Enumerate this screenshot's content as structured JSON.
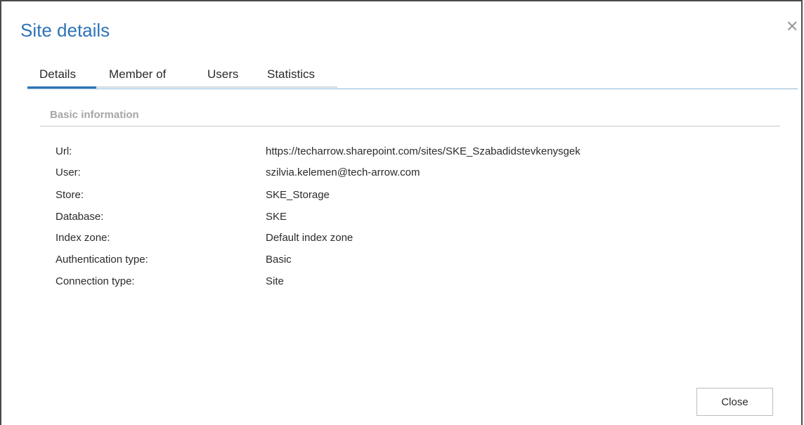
{
  "dialog": {
    "title": "Site details",
    "close_icon": "close-icon"
  },
  "tabs": [
    {
      "label": "Details",
      "active": true
    },
    {
      "label": "Member of",
      "active": false
    },
    {
      "label": "Users",
      "active": false
    },
    {
      "label": "Statistics",
      "active": false
    }
  ],
  "section": {
    "title": "Basic information"
  },
  "details": [
    {
      "label": "Url:",
      "value": "https://techarrow.sharepoint.com/sites/SKE_Szabadidstevkenysgek"
    },
    {
      "label": "User:",
      "value": "szilvia.kelemen@tech-arrow.com"
    },
    {
      "label": "Store:",
      "value": "SKE_Storage"
    },
    {
      "label": "Database:",
      "value": "SKE"
    },
    {
      "label": "Index zone:",
      "value": "Default index zone"
    },
    {
      "label": "Authentication type:",
      "value": "Basic"
    },
    {
      "label": "Connection type:",
      "value": "Site"
    }
  ],
  "footer": {
    "close_label": "Close"
  },
  "colors": {
    "title": "#2f73b6",
    "tab_active": "#2f73b6",
    "tab_line": "#8fb8d8",
    "section_title": "#a6a6a6"
  }
}
